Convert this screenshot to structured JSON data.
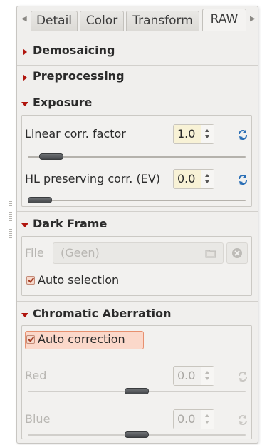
{
  "tabs": [
    {
      "label": "Detail",
      "active": false
    },
    {
      "label": "Color",
      "active": false
    },
    {
      "label": "Transform",
      "active": false
    },
    {
      "label": "RAW",
      "active": true
    }
  ],
  "sections": {
    "demosaicing": {
      "title": "Demosaicing",
      "expanded": false
    },
    "preprocessing": {
      "title": "Preprocessing",
      "expanded": false
    },
    "exposure": {
      "title": "Exposure",
      "expanded": true,
      "linear": {
        "label": "Linear corr. factor",
        "value": "1.0",
        "slider_fraction": 0.06
      },
      "hl": {
        "label": "HL preserving corr. (EV)",
        "value": "0.0",
        "slider_fraction": 0.0
      }
    },
    "darkframe": {
      "title": "Dark Frame",
      "expanded": true,
      "file_label": "File",
      "file_value": "(Geen)",
      "auto_selection_label": "Auto selection",
      "auto_selection_checked": true
    },
    "ca": {
      "title": "Chromatic Aberration",
      "expanded": true,
      "auto_correction_label": "Auto correction",
      "auto_correction_checked": true,
      "red": {
        "label": "Red",
        "value": "0.0",
        "slider_fraction": 0.5
      },
      "blue": {
        "label": "Blue",
        "value": "0.0",
        "slider_fraction": 0.5
      }
    }
  },
  "icons": {
    "expanded_caret": "caret-down-icon",
    "collapsed_caret": "caret-right-icon",
    "reset": "reset-icon",
    "folder": "folder-icon",
    "clear": "clear-icon",
    "tab_left": "chevron-left-icon",
    "tab_right": "chevron-right-icon"
  },
  "colors": {
    "caret": "#b0150e",
    "spin_value_bg": "#f8f2d6",
    "reset_icon": "#2b6fb5",
    "toggle_highlight": "#fbd8ca"
  }
}
